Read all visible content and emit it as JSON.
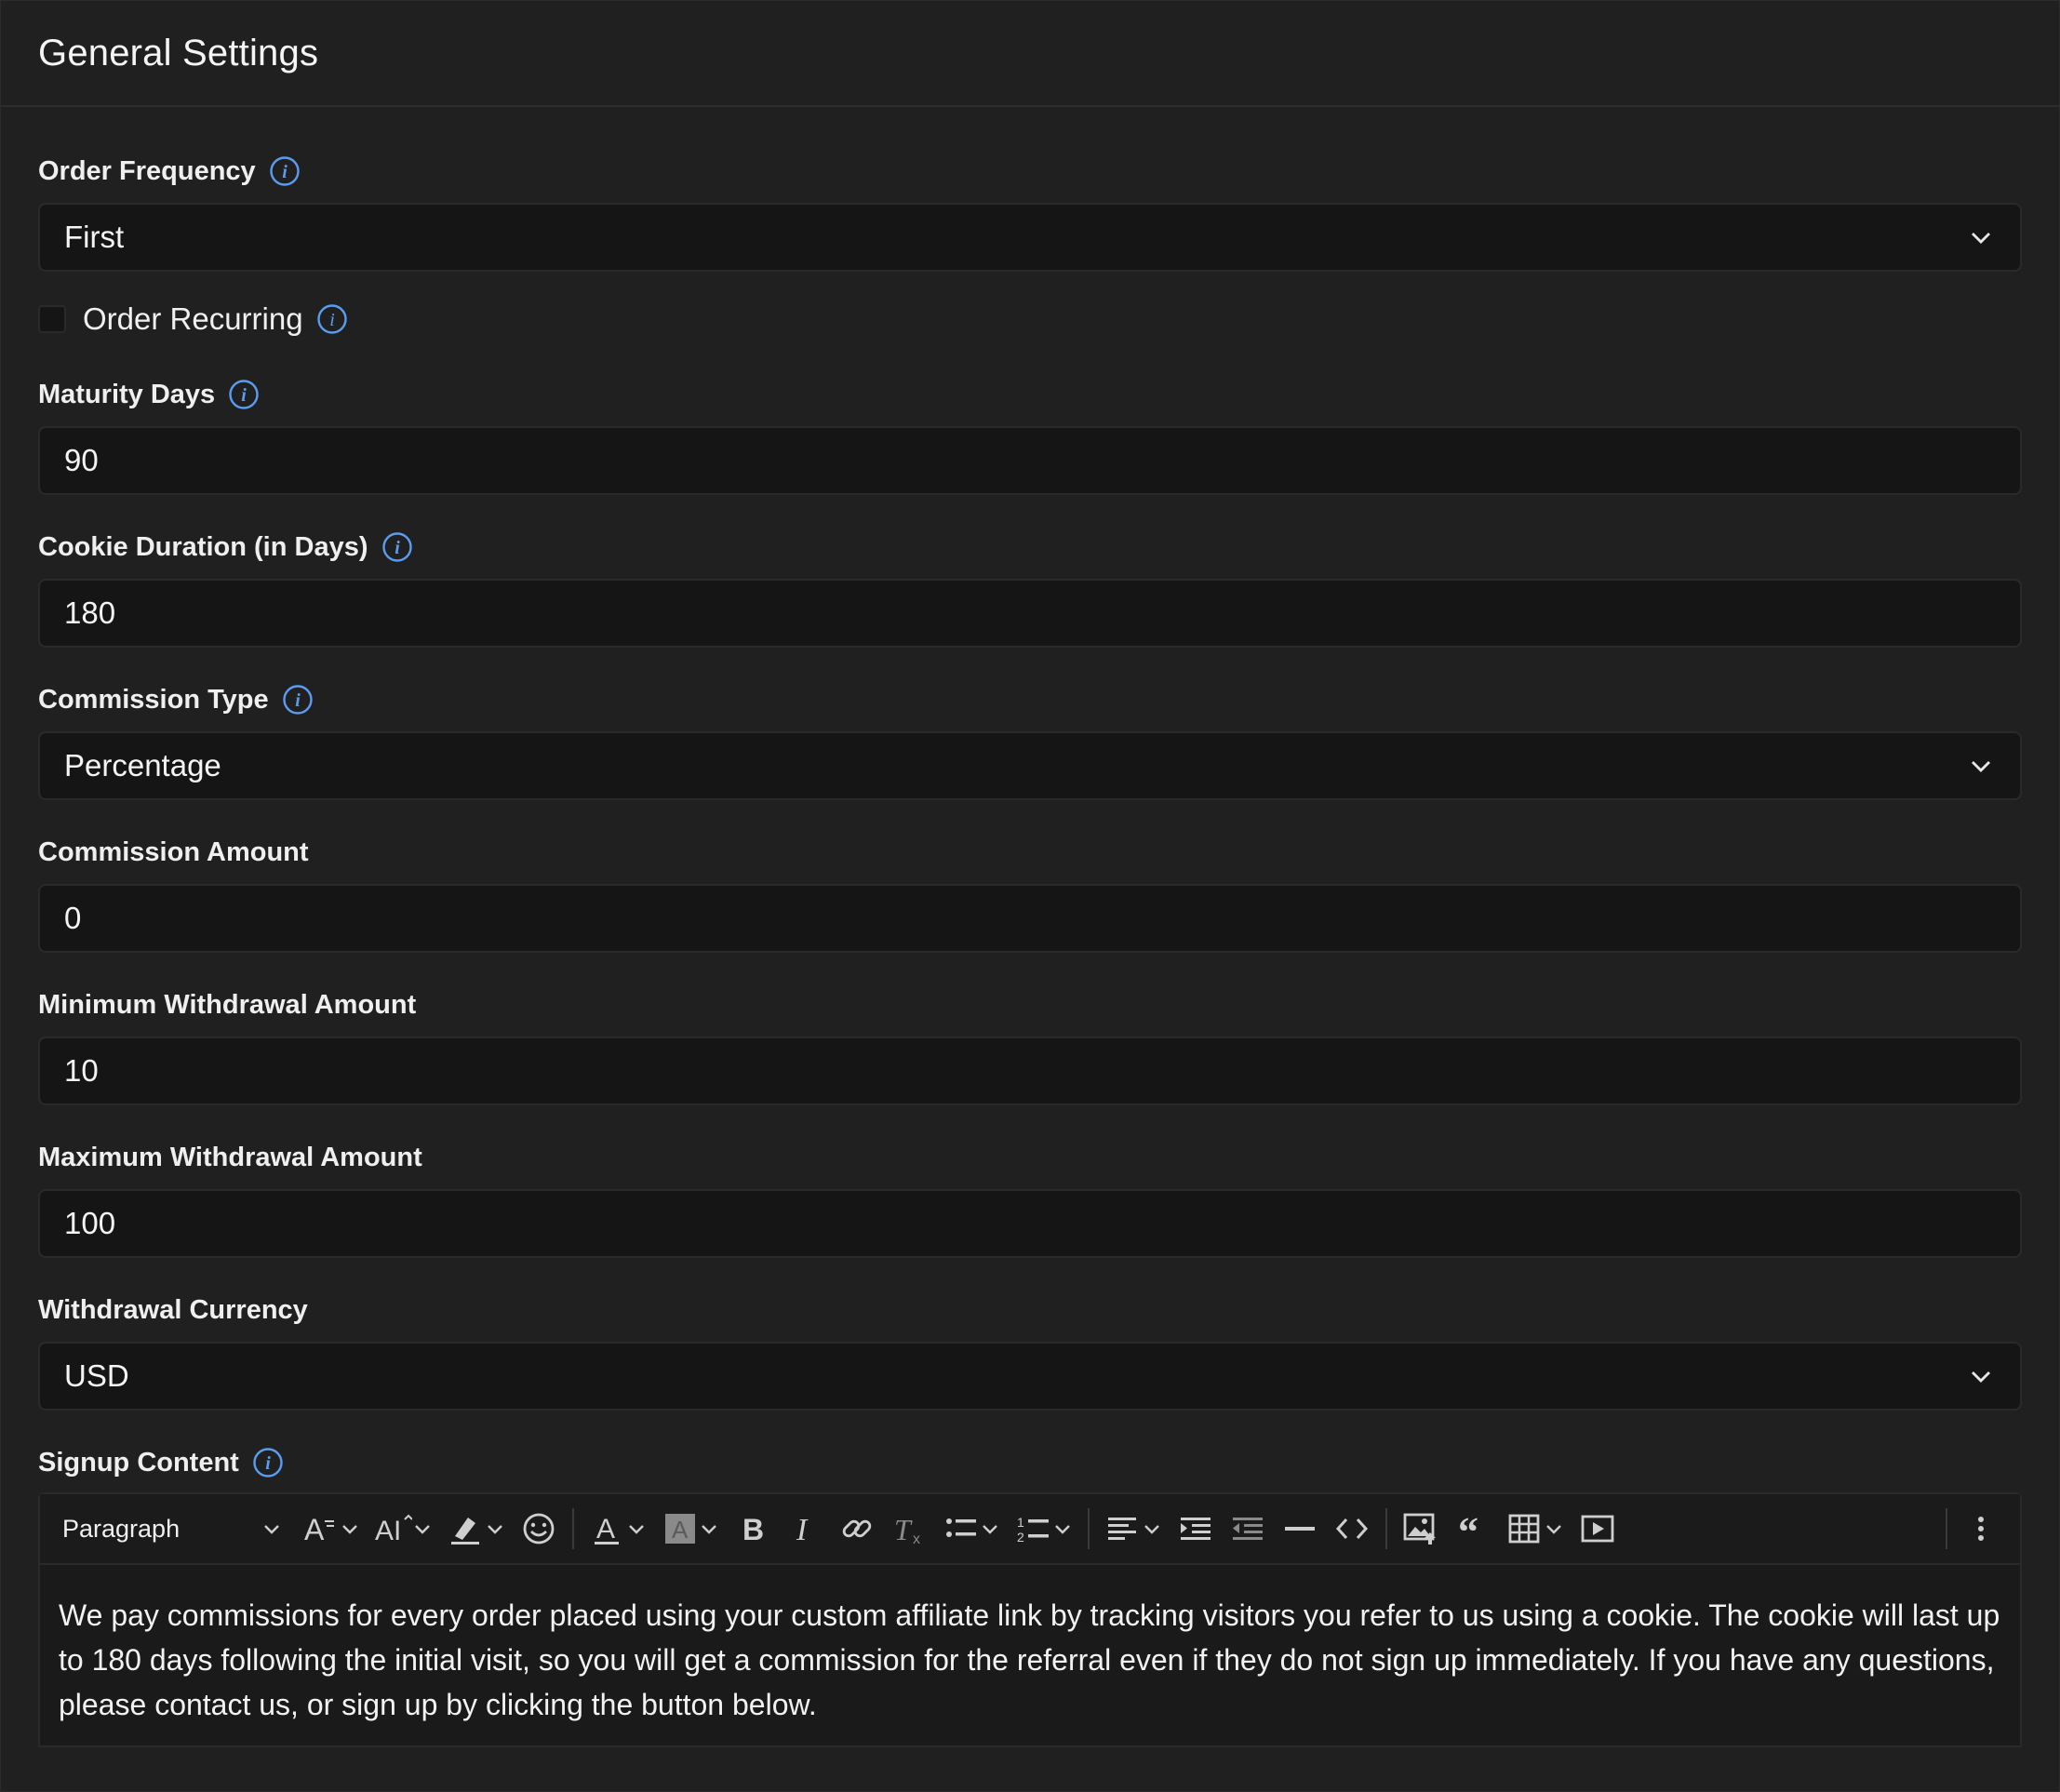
{
  "header": {
    "title": "General Settings"
  },
  "fields": {
    "order_frequency": {
      "label": "Order Frequency",
      "value": "First"
    },
    "order_recurring": {
      "label": "Order Recurring",
      "checked": false
    },
    "maturity_days": {
      "label": "Maturity Days",
      "value": "90"
    },
    "cookie_duration": {
      "label": "Cookie Duration (in Days)",
      "value": "180"
    },
    "commission_type": {
      "label": "Commission Type",
      "value": "Percentage"
    },
    "commission_amount": {
      "label": "Commission Amount",
      "value": "0"
    },
    "min_withdrawal": {
      "label": "Minimum Withdrawal Amount",
      "value": "10"
    },
    "max_withdrawal": {
      "label": "Maximum Withdrawal Amount",
      "value": "100"
    },
    "withdrawal_currency": {
      "label": "Withdrawal Currency",
      "value": "USD"
    },
    "signup_content": {
      "label": "Signup Content",
      "toolbar": {
        "paragraph": "Paragraph"
      },
      "text": "We pay commissions for every order placed using your custom affiliate link by tracking visitors you refer to us using a cookie. The cookie will last up to 180 days following the initial visit, so you will get a commission for the referral even if they do not sign up immediately. If you have any questions, please contact us, or sign up by clicking the button below."
    }
  },
  "colors": {
    "background": "#202020",
    "input": "#151515",
    "border": "#2a2a2a",
    "info_accent": "#5b9cf0"
  },
  "icons": [
    "info-icon",
    "chevron-down-icon",
    "font-family-icon",
    "font-size-icon",
    "highlight-icon",
    "emoji-icon",
    "font-color-icon",
    "background-color-icon",
    "bold-icon",
    "italic-icon",
    "link-icon",
    "clear-format-icon",
    "bulleted-list-icon",
    "numbered-list-icon",
    "align-icon",
    "indent-icon",
    "outdent-icon",
    "horizontal-line-icon",
    "source-code-icon",
    "insert-image-icon",
    "blockquote-icon",
    "table-icon",
    "media-embed-icon",
    "more-options-icon"
  ]
}
